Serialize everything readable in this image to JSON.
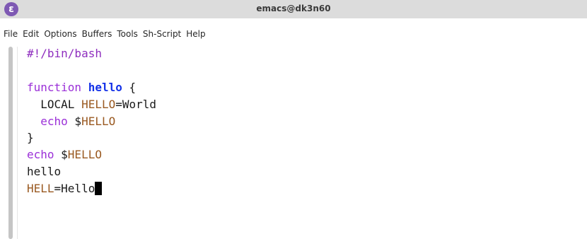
{
  "window": {
    "title": "emacs@dk3n60",
    "icon": "emacs-icon"
  },
  "menubar": {
    "items": [
      "File",
      "Edit",
      "Options",
      "Buffers",
      "Tools",
      "Sh-Script",
      "Help"
    ]
  },
  "editor": {
    "language": "bash",
    "lines": [
      [
        {
          "text": "#!/bin/bash",
          "type": "comment"
        }
      ],
      [],
      [
        {
          "text": "function",
          "type": "keyword"
        },
        {
          "text": " ",
          "type": "plain"
        },
        {
          "text": "hello",
          "type": "function"
        },
        {
          "text": " {",
          "type": "plain"
        }
      ],
      [
        {
          "text": "  LOCAL ",
          "type": "plain"
        },
        {
          "text": "HELLO",
          "type": "variable"
        },
        {
          "text": "=World",
          "type": "plain"
        }
      ],
      [
        {
          "text": "  ",
          "type": "plain"
        },
        {
          "text": "echo",
          "type": "keyword"
        },
        {
          "text": " $",
          "type": "plain"
        },
        {
          "text": "HELLO",
          "type": "variable"
        }
      ],
      [
        {
          "text": "}",
          "type": "plain"
        }
      ],
      [
        {
          "text": "echo",
          "type": "keyword"
        },
        {
          "text": " $",
          "type": "plain"
        },
        {
          "text": "HELLO",
          "type": "variable"
        }
      ],
      [
        {
          "text": "hello",
          "type": "plain"
        }
      ],
      [
        {
          "text": "HELL",
          "type": "variable"
        },
        {
          "text": "=Hello",
          "type": "plain"
        }
      ]
    ],
    "cursor_line": 8
  }
}
